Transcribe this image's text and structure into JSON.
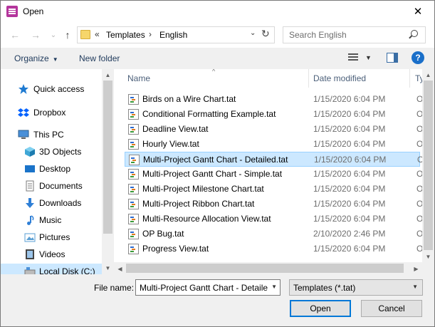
{
  "window": {
    "title": "Open",
    "close_glyph": "✕"
  },
  "nav": {
    "back_glyph": "←",
    "forward_glyph": "→",
    "recent_glyph": "⌄",
    "up_glyph": "↑",
    "address": {
      "prefix": "«",
      "crumbs": [
        "Templates",
        "English"
      ],
      "separator": "›",
      "dropdown_glyph": "⌄",
      "refresh_glyph": "↻"
    },
    "search": {
      "placeholder": "Search English"
    }
  },
  "toolbar": {
    "organize": "Organize",
    "new_folder": "New folder",
    "caret": "▼",
    "help": "?"
  },
  "nav_pane": {
    "items": [
      {
        "label": "Quick access",
        "icon": "star-icon",
        "color": "#1e7ad1"
      },
      {
        "label": "Dropbox",
        "icon": "dropbox-icon",
        "color": "#0061fe"
      },
      {
        "label": "This PC",
        "icon": "computer-icon",
        "color": "#4a90d9"
      },
      {
        "label": "3D Objects",
        "icon": "cube-icon",
        "color": "#3fa7d6"
      },
      {
        "label": "Desktop",
        "icon": "desktop-icon",
        "color": "#1a73c9"
      },
      {
        "label": "Documents",
        "icon": "document-icon",
        "color": "#7a7a7a"
      },
      {
        "label": "Downloads",
        "icon": "download-icon",
        "color": "#2f7fd6"
      },
      {
        "label": "Music",
        "icon": "music-icon",
        "color": "#2f7fd6"
      },
      {
        "label": "Pictures",
        "icon": "pictures-icon",
        "color": "#5a9fd4"
      },
      {
        "label": "Videos",
        "icon": "videos-icon",
        "color": "#444444"
      },
      {
        "label": "Local Disk (C:)",
        "icon": "disk-icon",
        "color": "#4a90d9"
      }
    ]
  },
  "columns": {
    "name": "Name",
    "date": "Date modified",
    "type": "Ty",
    "sort_glyph": "^"
  },
  "files": [
    {
      "name": "Birds on a Wire Chart.tat",
      "date": "1/15/2020 6:04 PM",
      "type": "O"
    },
    {
      "name": "Conditional Formatting Example.tat",
      "date": "1/15/2020 6:04 PM",
      "type": "O"
    },
    {
      "name": "Deadline View.tat",
      "date": "1/15/2020 6:04 PM",
      "type": "O"
    },
    {
      "name": "Hourly View.tat",
      "date": "1/15/2020 6:04 PM",
      "type": "O"
    },
    {
      "name": "Multi-Project Gantt Chart - Detailed.tat",
      "date": "1/15/2020 6:04 PM",
      "type": "O",
      "selected": true
    },
    {
      "name": "Multi-Project Gantt Chart - Simple.tat",
      "date": "1/15/2020 6:04 PM",
      "type": "O"
    },
    {
      "name": "Multi-Project Milestone Chart.tat",
      "date": "1/15/2020 6:04 PM",
      "type": "O"
    },
    {
      "name": "Multi-Project Ribbon Chart.tat",
      "date": "1/15/2020 6:04 PM",
      "type": "O"
    },
    {
      "name": "Multi-Resource Allocation View.tat",
      "date": "1/15/2020 6:04 PM",
      "type": "O"
    },
    {
      "name": "OP Bug.tat",
      "date": "2/10/2020 2:46 PM",
      "type": "O"
    },
    {
      "name": "Progress View.tat",
      "date": "1/15/2020 6:04 PM",
      "type": "O"
    }
  ],
  "scroll": {
    "up": "▲",
    "down": "▼",
    "left": "◀",
    "right": "▶"
  },
  "bottom": {
    "file_name_label": "File name:",
    "file_name_value": "Multi-Project Gantt Chart - Detailed.tat",
    "file_type": "Templates (*.tat)",
    "caret": "▼",
    "open": "Open",
    "cancel": "Cancel"
  }
}
